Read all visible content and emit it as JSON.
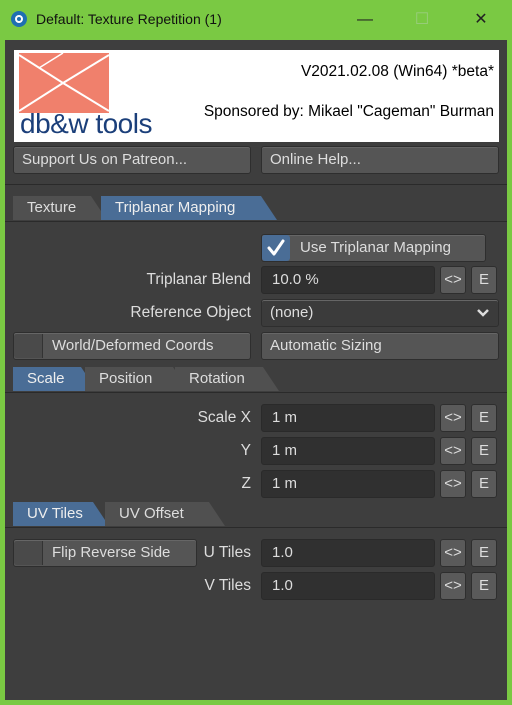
{
  "window": {
    "title": "Default: Texture Repetition (1)",
    "minimize_icon": "minimize-icon",
    "maximize_icon": "maximize-icon",
    "close_icon": "close-icon",
    "accent": "#7ac943"
  },
  "banner": {
    "logo_text": "db&w tools",
    "version": "V2021.02.08 (Win64) *beta*",
    "sponsor": "Sponsored by: Mikael \"Cageman\" Burman"
  },
  "top_buttons": {
    "patreon": "Support Us on Patreon...",
    "help": "Online Help..."
  },
  "main_tabs": [
    {
      "label": "Texture",
      "active": false
    },
    {
      "label": "Triplanar Mapping",
      "active": true
    }
  ],
  "triplanar": {
    "use_label": "Use Triplanar Mapping",
    "use_checked": true,
    "blend_label": "Triplanar Blend",
    "blend_value": "10.0 %",
    "ref_label": "Reference Object",
    "ref_value": "(none)",
    "world_label": "World/Deformed Coords",
    "auto_label": "Automatic Sizing"
  },
  "transform_tabs": [
    {
      "label": "Scale",
      "active": true
    },
    {
      "label": "Position",
      "active": false
    },
    {
      "label": "Rotation",
      "active": false
    }
  ],
  "scale": {
    "x_label": "Scale X",
    "x_value": "1 m",
    "y_label": "Y",
    "y_value": "1 m",
    "z_label": "Z",
    "z_value": "1 m"
  },
  "uv_tabs": [
    {
      "label": "UV Tiles",
      "active": true
    },
    {
      "label": "UV Offset",
      "active": false
    }
  ],
  "uv": {
    "flip_label": "Flip Reverse Side",
    "u_label": "U Tiles",
    "u_value": "1.0",
    "v_label": "V Tiles",
    "v_value": "1.0"
  },
  "envelope_symbol": "<>",
  "e_label": "E",
  "colors": {
    "active_tab": "#4a6d96",
    "panel": "#3e3e3e"
  }
}
